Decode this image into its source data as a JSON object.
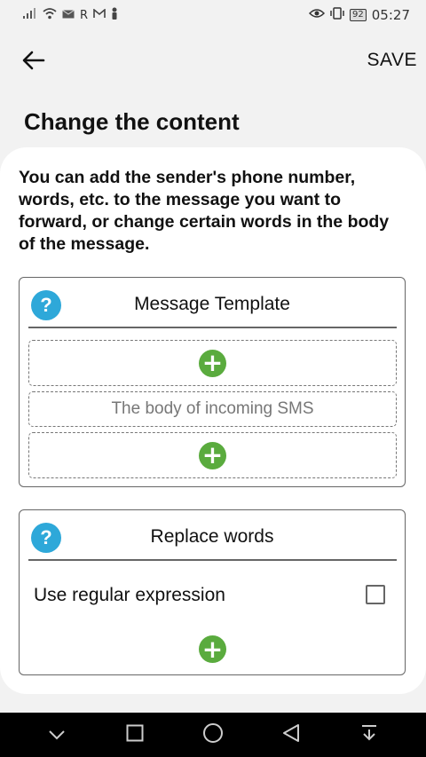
{
  "status_bar": {
    "carrier_letters": "R",
    "battery": "92",
    "time": "05:27"
  },
  "app_bar": {
    "save_label": "SAVE"
  },
  "page_title": "Change the content",
  "description": "You can add the sender's phone number, words, etc. to the message you want to forward, or change certain words in the body of the message.",
  "template_section": {
    "help_glyph": "?",
    "title": "Message Template",
    "slots": [
      {
        "type": "add"
      },
      {
        "type": "text",
        "label": "The body of incoming SMS"
      },
      {
        "type": "add"
      }
    ]
  },
  "replace_section": {
    "help_glyph": "?",
    "title": "Replace words",
    "regex_label": "Use regular expression",
    "regex_checked": false
  },
  "icons": {
    "back": "arrow-left-icon",
    "help": "help-circle-icon",
    "add": "plus-circle-icon",
    "nav": [
      "chevron-down-icon",
      "square-icon",
      "circle-icon",
      "triangle-back-icon",
      "download-icon"
    ]
  },
  "colors": {
    "help_blue": "#2ea8d9",
    "add_green": "#5aab3e",
    "background": "#f2f2f2",
    "nav_bar": "#000000"
  }
}
